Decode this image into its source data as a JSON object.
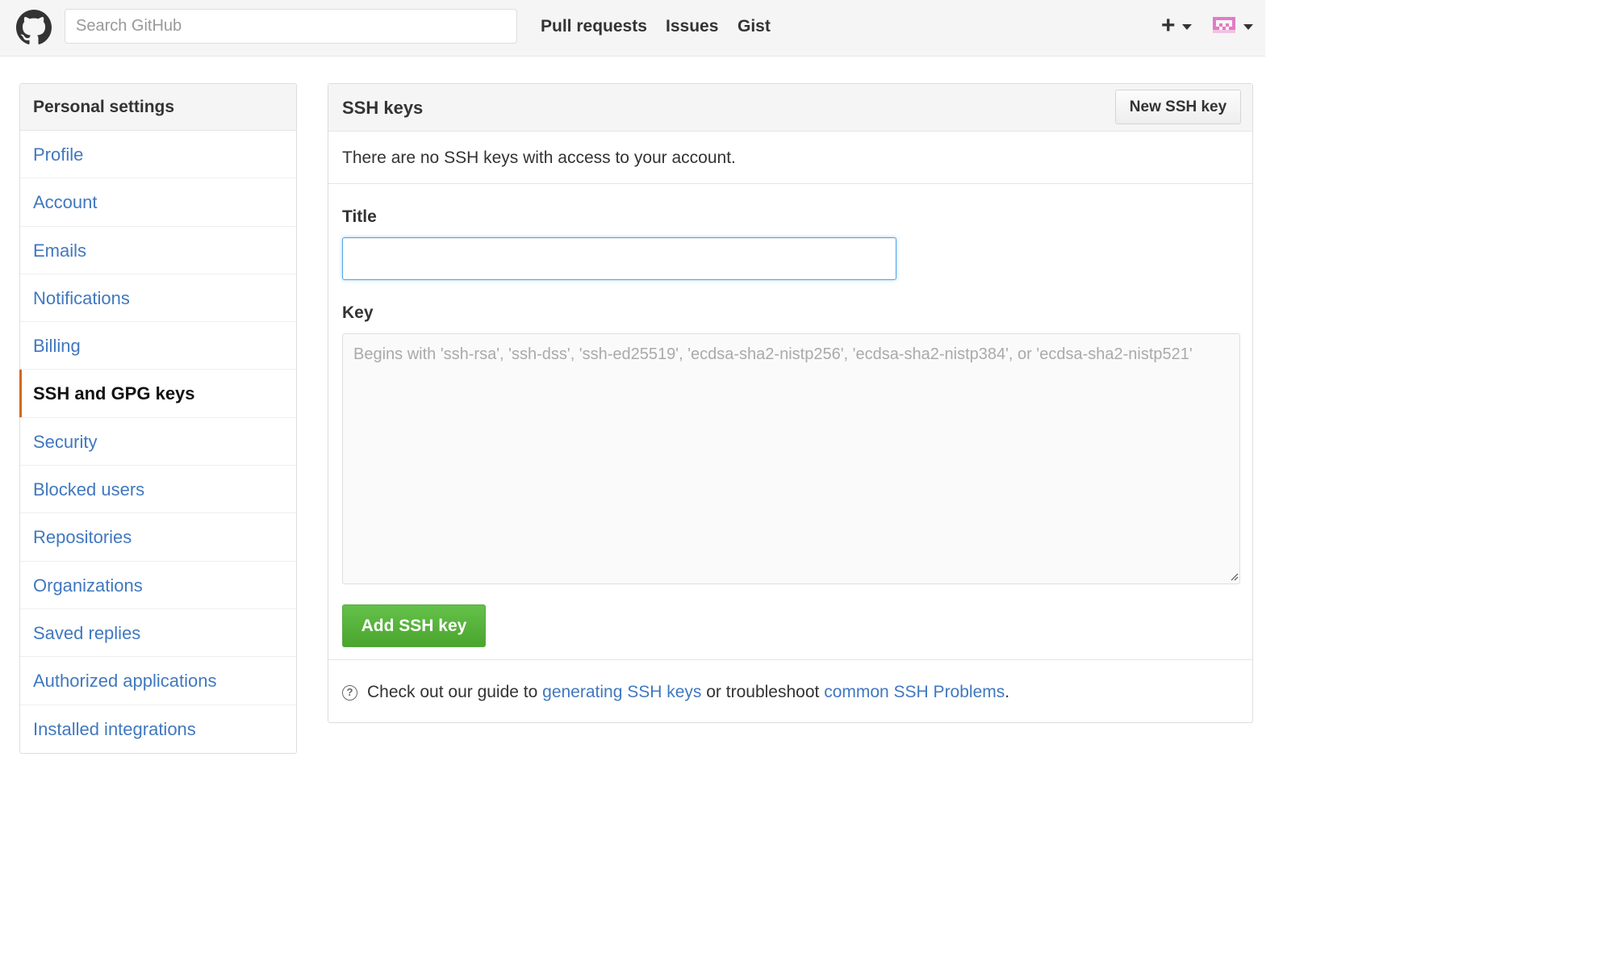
{
  "header": {
    "search_placeholder": "Search GitHub",
    "nav": [
      "Pull requests",
      "Issues",
      "Gist"
    ],
    "new_menu_icon": "+",
    "avatar_icon": "identicon"
  },
  "sidebar": {
    "heading": "Personal settings",
    "items": [
      {
        "label": "Profile"
      },
      {
        "label": "Account"
      },
      {
        "label": "Emails"
      },
      {
        "label": "Notifications"
      },
      {
        "label": "Billing"
      },
      {
        "label": "SSH and GPG keys",
        "selected": true
      },
      {
        "label": "Security"
      },
      {
        "label": "Blocked users"
      },
      {
        "label": "Repositories"
      },
      {
        "label": "Organizations"
      },
      {
        "label": "Saved replies"
      },
      {
        "label": "Authorized applications"
      },
      {
        "label": "Installed integrations"
      }
    ]
  },
  "main": {
    "title": "SSH keys",
    "new_key_button": "New SSH key",
    "empty_message": "There are no SSH keys with access to your account.",
    "title_label": "Title",
    "title_value": "",
    "key_label": "Key",
    "key_placeholder": "Begins with 'ssh-rsa', 'ssh-dss', 'ssh-ed25519', 'ecdsa-sha2-nistp256', 'ecdsa-sha2-nistp384', or 'ecdsa-sha2-nistp521'",
    "add_button": "Add SSH key",
    "help": {
      "prefix": "Check out our guide to ",
      "link1": "generating SSH keys",
      "middle": " or troubleshoot ",
      "link2": "common SSH Problems",
      "suffix": "."
    }
  },
  "colors": {
    "link": "#4078c0",
    "selected_accent": "#d26911",
    "primary_button": "#55b337"
  }
}
